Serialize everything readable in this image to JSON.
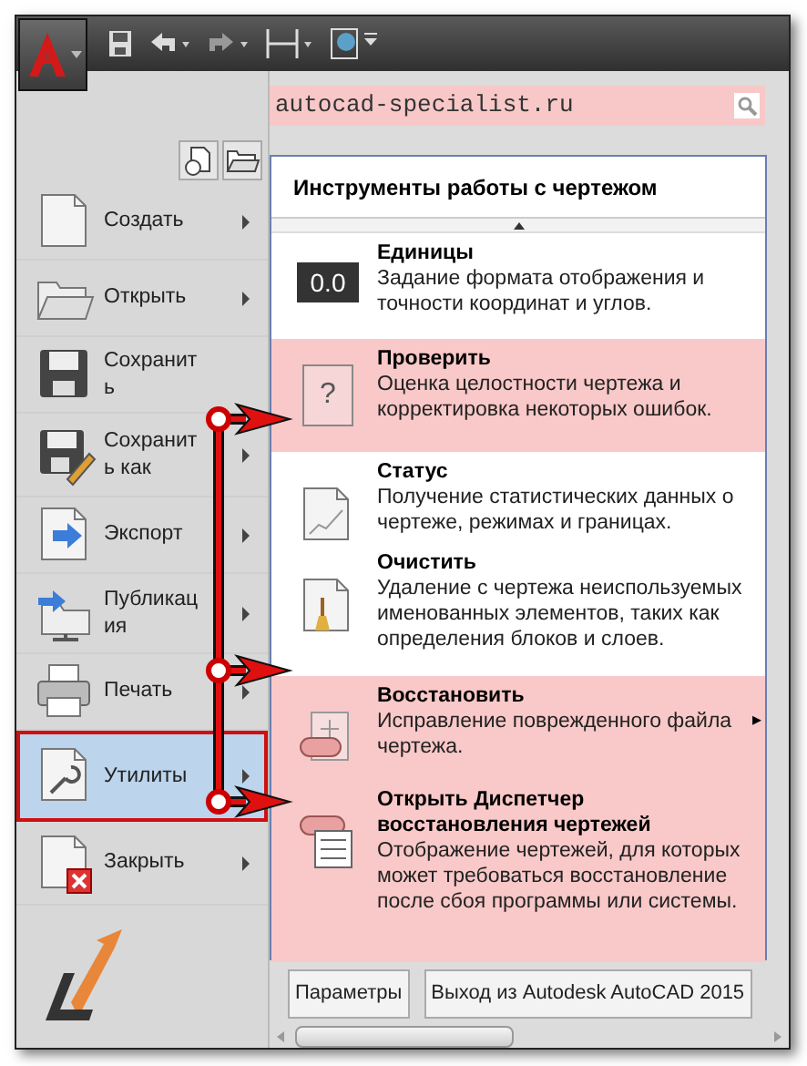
{
  "search": {
    "value": "autocad-specialist.ru"
  },
  "menu_items": [
    {
      "label": "Создать",
      "has_submenu": true,
      "selected": false
    },
    {
      "label": "Открыть",
      "has_submenu": true,
      "selected": false
    },
    {
      "label": "Сохранить",
      "has_submenu": false,
      "selected": false
    },
    {
      "label": "Сохранить как",
      "has_submenu": true,
      "selected": false
    },
    {
      "label": "Экспорт",
      "has_submenu": true,
      "selected": false
    },
    {
      "label": "Публикация",
      "has_submenu": true,
      "selected": false
    },
    {
      "label": "Печать",
      "has_submenu": true,
      "selected": false
    },
    {
      "label": "Утилиты",
      "has_submenu": true,
      "selected": true
    },
    {
      "label": "Закрыть",
      "has_submenu": true,
      "selected": false
    }
  ],
  "submenu": {
    "title": "Инструменты работы с чертежом",
    "items": [
      {
        "title": "Единицы",
        "description": "Задание формата отображения и точности координат и углов.",
        "highlighted": false,
        "has_submenu": false
      },
      {
        "title": "Проверить",
        "description": "Оценка целостности чертежа и корректировка некоторых ошибок.",
        "highlighted": true,
        "has_submenu": false
      },
      {
        "title": "Статус",
        "description": "Получение статистических данных о чертеже, режимах и границах.",
        "highlighted": false,
        "has_submenu": false
      },
      {
        "title": "Очистить",
        "description": "Удаление с чертежа неиспользуемых именованных элементов, таких как определения блоков и слоев.",
        "highlighted": false,
        "has_submenu": false
      },
      {
        "title": "Восстановить",
        "description": "Исправление поврежденного файла чертежа.",
        "highlighted": true,
        "has_submenu": true
      },
      {
        "title": "Открыть Диспетчер восстановления чертежей",
        "description": "Отображение чертежей, для которых может требоваться восстановление после сбоя программы или системы.",
        "highlighted": true,
        "has_submenu": false
      }
    ]
  },
  "units_icon_text": "0.0",
  "help_icon_text": "?",
  "submenu_arrow": "▸",
  "buttons": [
    {
      "label": "Параметры"
    },
    {
      "label": "Выход из Autodesk AutoCAD 2015"
    }
  ]
}
